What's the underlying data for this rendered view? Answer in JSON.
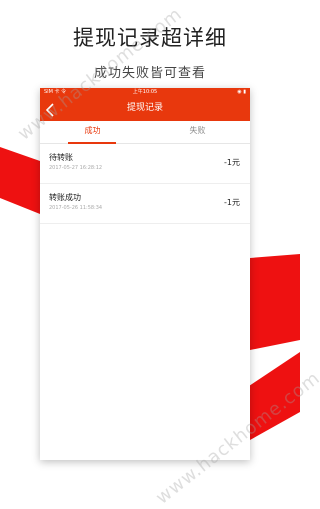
{
  "promo": {
    "title": "提现记录超详细",
    "subtitle": "成功失败皆可查看"
  },
  "statusbar": {
    "carrier": "SIM 卡 令",
    "time": "上午10:05",
    "right": "◉ ▮"
  },
  "navbar": {
    "back_icon": "chevron-left-icon",
    "title": "提现记录"
  },
  "tabs": [
    {
      "label": "成功",
      "active": true
    },
    {
      "label": "失败",
      "active": false
    }
  ],
  "records": [
    {
      "status": "待转账",
      "time": "2017-05-27 16:28:12",
      "amount": "-1元"
    },
    {
      "status": "转账成功",
      "time": "2017-05-26 11:58:34",
      "amount": "-1元"
    }
  ],
  "watermark": "www.hackhome.com",
  "colors": {
    "accent": "#e8380d",
    "stripe": "#ee1111"
  }
}
